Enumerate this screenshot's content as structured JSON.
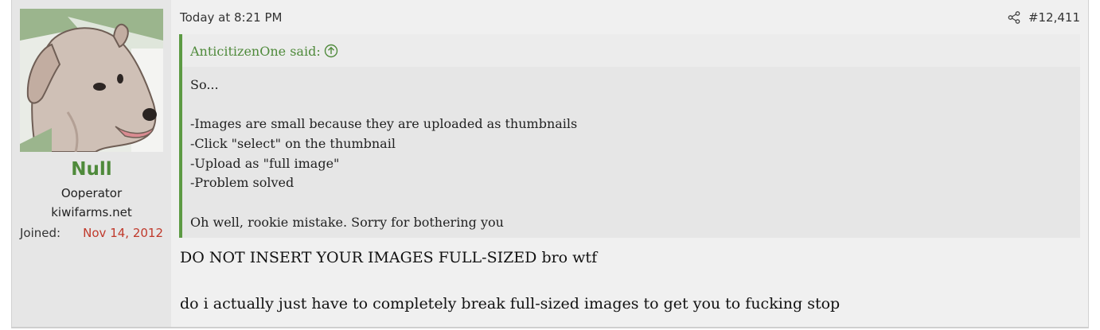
{
  "post": {
    "timestamp": "Today at 8:21 PM",
    "post_number": "#12,411",
    "share_icon": "share-icon"
  },
  "user": {
    "avatar_icon": "dog-avatar",
    "name": "Null",
    "title": "Ooperator",
    "banner": "kiwifarms.net",
    "joined_label": "Joined:",
    "joined_date": "Nov 14, 2012"
  },
  "quote": {
    "author": "AnticitizenOne said:",
    "jump_icon": "arrow-up-circle-icon",
    "lines": [
      "So...",
      "",
      "-Images are small because they are uploaded as thumbnails",
      "-Click \"select\" on the thumbnail",
      "-Upload as \"full image\"",
      "-Problem solved",
      "",
      "Oh well, rookie mistake. Sorry for bothering you"
    ]
  },
  "message": {
    "lines": [
      "DO NOT INSERT YOUR IMAGES FULL-SIZED bro wtf",
      "",
      "do i actually just have to completely break full-sized images to get you to fucking stop"
    ]
  },
  "colors": {
    "accent_green": "#4f8a3b",
    "quote_border": "#5c9a43",
    "joined_date": "#c0392b"
  }
}
